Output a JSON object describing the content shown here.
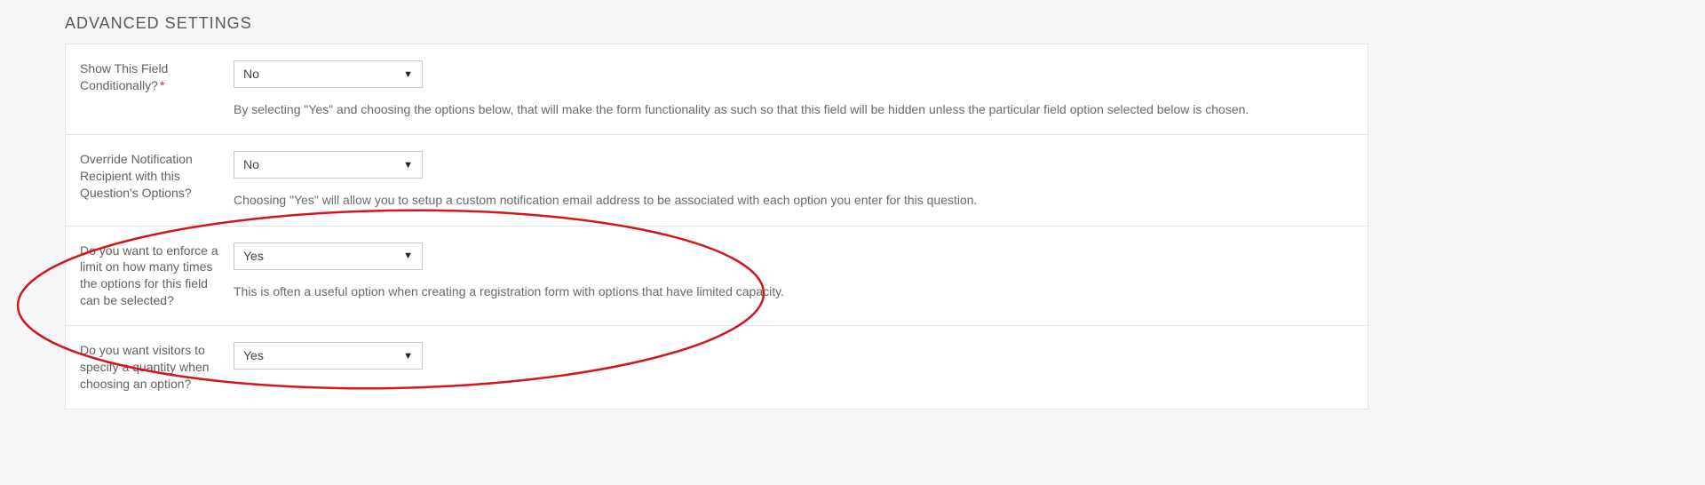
{
  "section": {
    "title": "ADVANCED SETTINGS"
  },
  "rows": {
    "show_conditionally": {
      "label": "Show This Field Conditionally?",
      "required_mark": "*",
      "selected": "No",
      "helper": "By selecting \"Yes\" and choosing the options below, that will make the form functionality as such so that this field will be hidden unless the particular field option selected below is chosen."
    },
    "override_recipient": {
      "label": "Override Notification Recipient with this Question's Options?",
      "selected": "No",
      "helper": "Choosing \"Yes\" will allow you to setup a custom notification email address to be associated with each option you enter for this question."
    },
    "enforce_limit": {
      "label": "Do you want to enforce a limit on how many times the options for this field can be selected?",
      "selected": "Yes",
      "helper": "This is often a useful option when creating a registration form with options that have limited capacity."
    },
    "specify_quantity": {
      "label": "Do you want visitors to specify a quantity when choosing an option?",
      "selected": "Yes"
    }
  },
  "annotation": {
    "color": "#d4151b"
  }
}
